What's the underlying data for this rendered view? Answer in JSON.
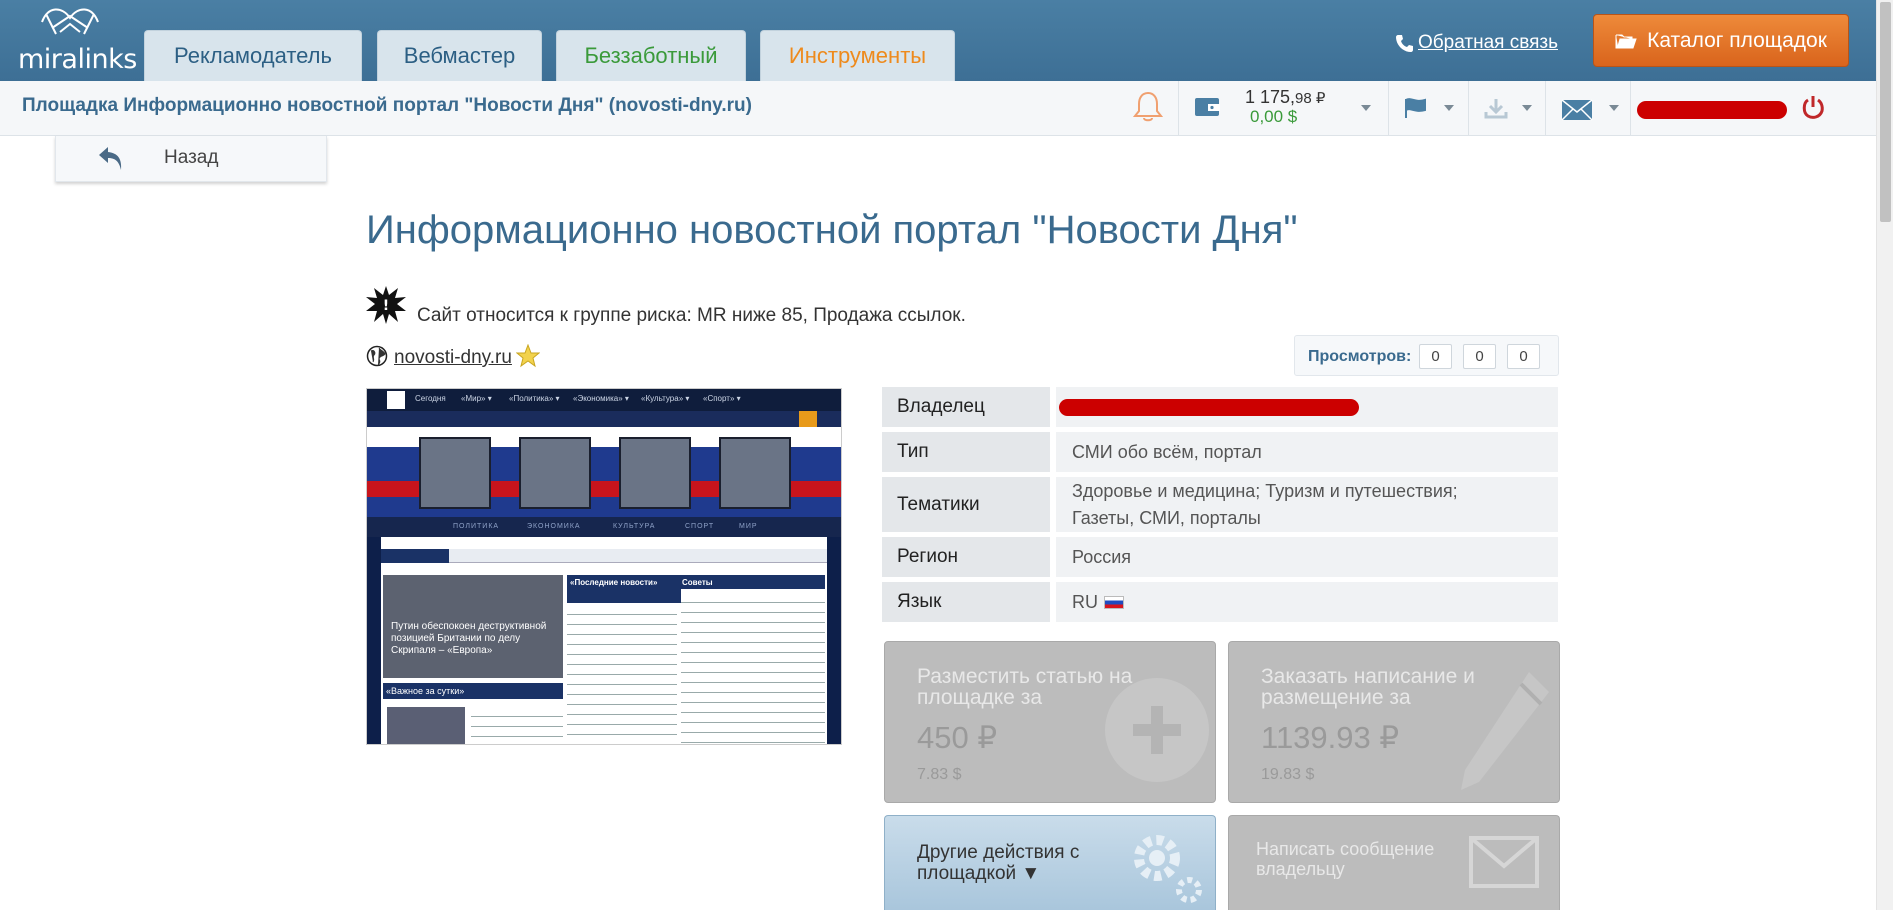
{
  "app": {
    "logo_text": "miralinks",
    "tabs": [
      {
        "label": "Рекламодатель"
      },
      {
        "label": "Вебмастер"
      },
      {
        "label": "Беззаботный"
      },
      {
        "label": "Инструменты"
      }
    ],
    "feedback_label": "Обратная связь",
    "catalog_label": "Каталог площадок"
  },
  "subbar": {
    "platform_title": "Площадка Информационно новостной портал \"Новости Дня\" (novosti-dny.ru)",
    "balance_rub_main": "1 175,",
    "balance_rub_cents": "98 ₽",
    "balance_usd": "0,00 $"
  },
  "back": {
    "label": "Назад"
  },
  "page": {
    "title": "Информационно новостной портал \"Новости Дня\"",
    "risk_text": "Сайт относится к группе риска: MR ниже 85, Продажа ссылок.",
    "site_link": "novosti-dny.ru",
    "views_label": "Просмотров:",
    "views": [
      "0",
      "0",
      "0"
    ]
  },
  "thumbnail": {
    "nav_items": [
      "Сегодня",
      "«Мир» ▾",
      "«Политика» ▾",
      "«Экономика» ▾",
      "«Культура» ▾",
      "«Спорт» ▾"
    ],
    "strip_items": [
      "ПОЛИТИКА",
      "ЭКОНОМИКА",
      "КУЛЬТУРА",
      "СПОРТ",
      "МИР"
    ],
    "photo_caption": "Путин обеспокоен деструктивной позицией Британии по делу Скрипаля – «Европа»",
    "col1_head": "«Последние новости»",
    "col2_head": "Советы",
    "important_head": "«Важное за сутки»"
  },
  "info": [
    {
      "label": "Владелец",
      "value": ""
    },
    {
      "label": "Тип",
      "value": "СМИ обо всём, портал"
    },
    {
      "label": "Тематики",
      "value": "Здоровье и медицина; Туризм и путешествия; Газеты, СМИ, порталы"
    },
    {
      "label": "Регион",
      "value": "Россия"
    },
    {
      "label": "Язык",
      "value": "RU"
    }
  ],
  "tiles": {
    "place_title": "Разместить статью на площадке за",
    "place_price": "450 ₽",
    "place_usd": "7.83 $",
    "order_title": "Заказать написание и размещение за",
    "order_price": "1139.93 ₽",
    "order_usd": "19.83 $",
    "other_actions": "Другие действия с площадкой ▼",
    "message_owner": "Написать сообщение владельцу"
  },
  "colors": {
    "brand_blue": "#3d6f95",
    "accent_orange": "#d9641c",
    "link_blue": "#3a6a8e",
    "usd_green": "#3a9a3a"
  }
}
